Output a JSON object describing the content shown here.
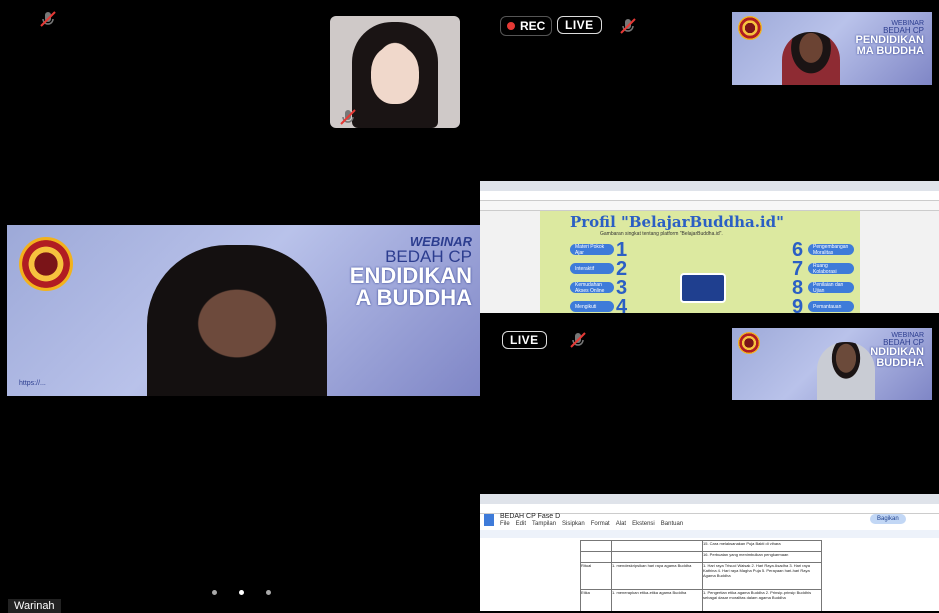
{
  "meeting": {
    "rec_label": "REC",
    "live_label": "LIVE",
    "live_label_2": "LIVE",
    "active_speaker_name": "Warinah"
  },
  "webinar": {
    "line1": "WEBINAR",
    "line2": "BEDAH CP",
    "line3": "ENDIDIKAN",
    "line4": "A BUDDHA",
    "small_line3": "PENDIDIKAN",
    "small_line4": "MA BUDDHA",
    "small_line3b": "NDIDIKAN",
    "small_line4b": "A BUDDHA",
    "url": "https://..."
  },
  "shared_screen_1": {
    "slide_title": "Profil \"BelajarBuddha.id\"",
    "slide_subtitle": "Gambaran singkat tentang platform \"BelajarBuddha.id\".",
    "left_items": [
      "Materi Pokok Ajar",
      "Interaktif",
      "Kemudahan Akses Online",
      "Mengikuti"
    ],
    "left_numbers": [
      "1",
      "2",
      "3",
      "4"
    ],
    "right_items": [
      "Pengembangan Moralitas",
      "Ruang Kolaborasi",
      "Penilaian dan Ujian",
      "Pemantauan"
    ],
    "right_numbers": [
      "6",
      "7",
      "8",
      "9"
    ]
  },
  "shared_screen_2": {
    "doc_title": "BEDAH CP Fase D",
    "menu": [
      "File",
      "Edit",
      "Tampilan",
      "Sisipkan",
      "Format",
      "Alat",
      "Ekstensi",
      "Bantuan"
    ],
    "share_button": "Bagikan",
    "rows": [
      {
        "col1": "",
        "col2": "",
        "col3": "15. Cara melaksanakan Puja Bakti di vihara",
        "col4": ""
      },
      {
        "col1": "",
        "col2": "",
        "col3": "16. Perbuatan yang menimbulkan pengkarmaan",
        "col4": ""
      },
      {
        "col1": "Ritual",
        "col2": "1. mendeskripsikan hari raya agama Buddha",
        "col3": "1. Hari raya Trisuci Waisak  2. Hari Raya Asadha  3. Hari raya Kathina  4. Hari raya Magha Puja  5. Perayaan hari-hari Raya Agama Buddha",
        "col4": ""
      },
      {
        "col1": "Etika",
        "col2": "1. menerapkan etika-etika agama Buddha",
        "col3": "1. Pengertian etika agama Buddha  2. Prinsip-prinsip Buddhis sebagai dasar moralitas dalam agama Buddha",
        "col4": ""
      }
    ]
  },
  "colors": {
    "background": "#000000",
    "rec_dot": "#e53935",
    "muted_icon": "#e53935",
    "webinar_bg": "#a9b3e2",
    "slide_green": "#dce9a0",
    "pill_blue": "#3e7bd9"
  }
}
